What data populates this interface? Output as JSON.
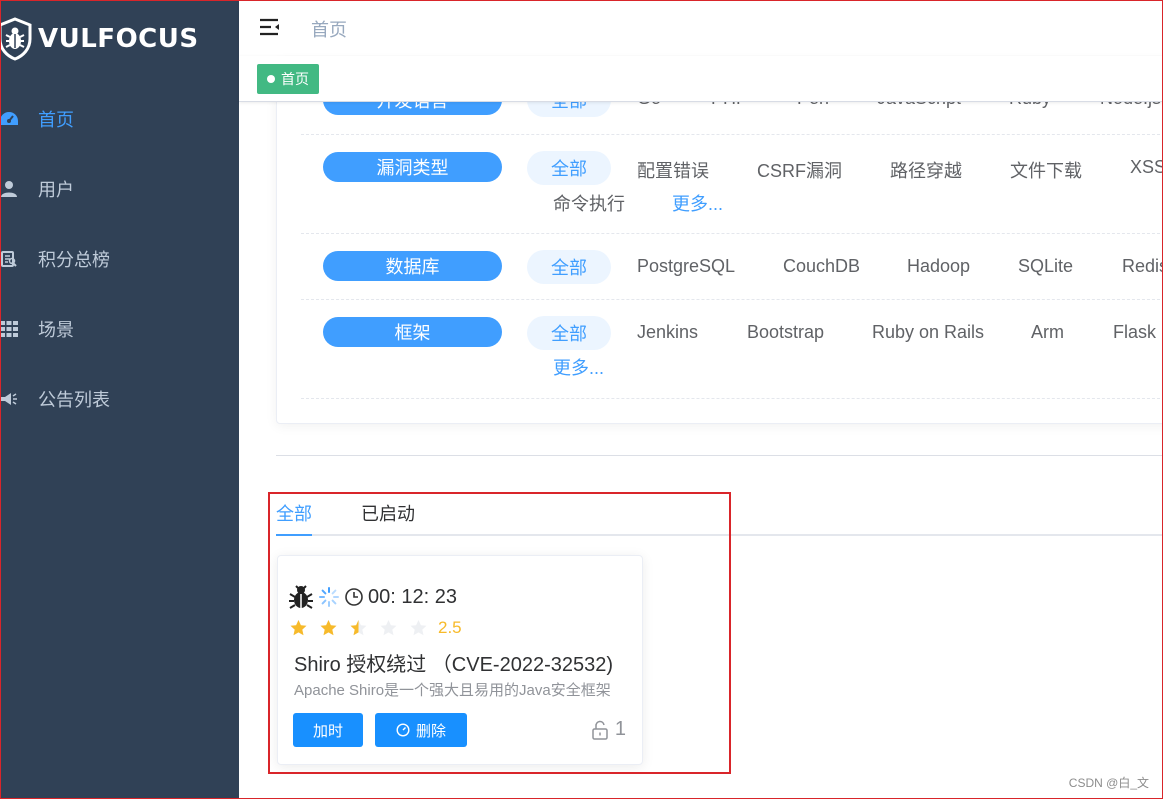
{
  "app": {
    "logo_text": "VULFOCUS"
  },
  "sidebar": {
    "items": [
      {
        "label": "首页",
        "icon": "dashboard-icon",
        "active": true
      },
      {
        "label": "用户",
        "icon": "user-icon",
        "active": false
      },
      {
        "label": "积分总榜",
        "icon": "ranking-icon",
        "active": false
      },
      {
        "label": "场景",
        "icon": "grid-icon",
        "active": false
      },
      {
        "label": "公告列表",
        "icon": "megaphone-icon",
        "active": false
      }
    ]
  },
  "header": {
    "breadcrumb": "首页"
  },
  "tagsview": {
    "tag_label": "首页"
  },
  "filters": {
    "rows": [
      {
        "label": "开发语言",
        "all": "全部",
        "options": [
          "Go",
          "PHP",
          "Perl",
          "JavaScript",
          "Ruby",
          "Node.js"
        ]
      },
      {
        "label": "漏洞类型",
        "all": "全部",
        "options": [
          "配置错误",
          "CSRF漏洞",
          "路径穿越",
          "文件下载",
          "XSS",
          "命令执行"
        ],
        "more": "更多..."
      },
      {
        "label": "数据库",
        "all": "全部",
        "options": [
          "PostgreSQL",
          "CouchDB",
          "Hadoop",
          "SQLite",
          "Redis"
        ]
      },
      {
        "label": "框架",
        "all": "全部",
        "options": [
          "Jenkins",
          "Bootstrap",
          "Ruby on Rails",
          "Arm",
          "Flask"
        ],
        "more": "更多..."
      }
    ]
  },
  "tabs": [
    {
      "label": "全部",
      "active": true
    },
    {
      "label": "已启动",
      "active": false
    }
  ],
  "scene_card": {
    "timer": "00: 12: 23",
    "rating": 2.5,
    "rating_text": "2.5",
    "rating_max": 5,
    "title": "Shiro 授权绕过 （CVE-2022-32532)",
    "description": "Apache Shiro是一个强大且易用的Java安全框架",
    "add_time_label": "加时",
    "delete_label": "删除",
    "lock_count": "1"
  },
  "watermark": "CSDN @白_文",
  "colors": {
    "sidebar_bg": "#304156",
    "primary": "#409eff",
    "tag_green": "#42b983",
    "star": "#f7ba2a",
    "highlight": "#d9252a"
  }
}
